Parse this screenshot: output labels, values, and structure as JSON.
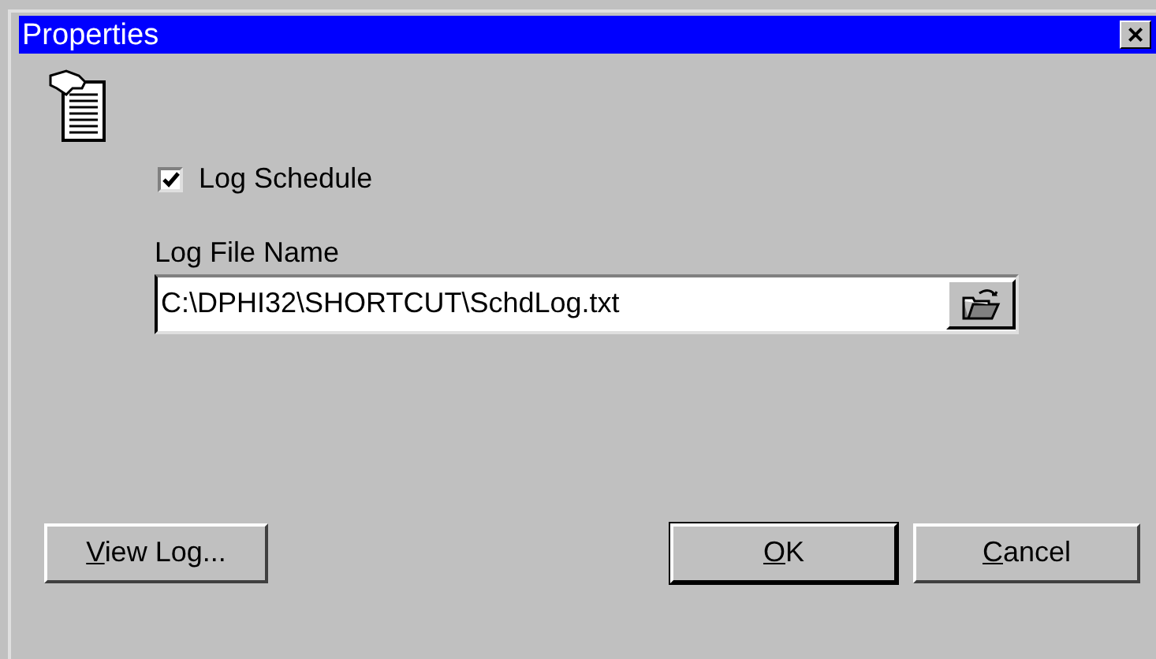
{
  "window": {
    "title": "Properties",
    "close": "×"
  },
  "log_schedule": {
    "label": "Log Schedule",
    "checked": true
  },
  "log_file": {
    "label": "Log File Name",
    "value": "C:\\DPHI32\\SHORTCUT\\SchdLog.txt"
  },
  "buttons": [
    {
      "kind": "left",
      "mnemonic": "V",
      "rest": "iew Log...",
      "default": false
    },
    {
      "kind": "right",
      "mnemonic": "O",
      "rest": "K",
      "default": true
    },
    {
      "kind": "right",
      "mnemonic": "C",
      "rest": "ancel",
      "default": false
    }
  ]
}
